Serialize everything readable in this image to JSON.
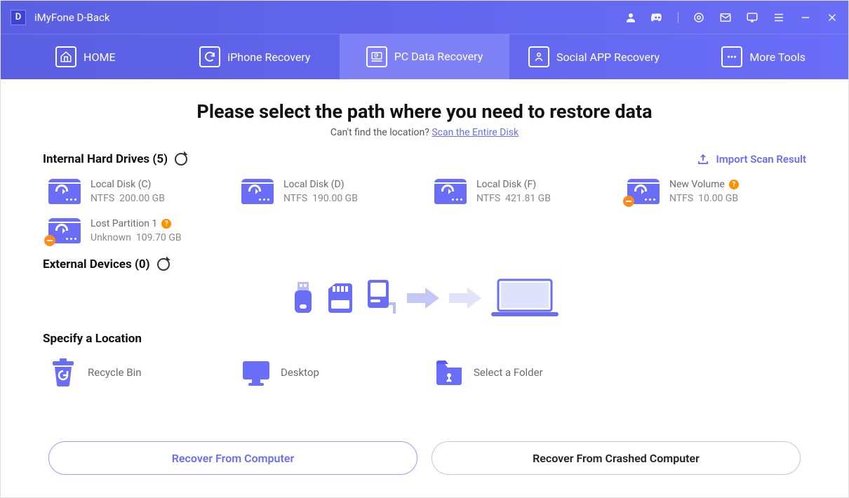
{
  "app": {
    "name": "iMyFone D-Back",
    "logo_letter": "D"
  },
  "titlebar_icons": [
    "user-icon",
    "discord-icon",
    "settings-icon",
    "mail-icon",
    "feedback-icon",
    "menu-icon",
    "minimize-icon",
    "close-icon"
  ],
  "tabs": [
    {
      "label": "HOME"
    },
    {
      "label": "iPhone Recovery"
    },
    {
      "label": "PC Data Recovery"
    },
    {
      "label": "Social APP Recovery"
    },
    {
      "label": "More Tools"
    }
  ],
  "active_tab_index": 2,
  "headline": "Please select the path where you need to restore data",
  "subline_prefix": "Can't find the location? ",
  "subline_link": "Scan the Entire Disk",
  "import_link": "Import Scan Result",
  "sections": {
    "internal": {
      "title": "Internal Hard Drives (5)"
    },
    "external": {
      "title": "External Devices (0)"
    },
    "specify": {
      "title": "Specify a Location"
    }
  },
  "drives": [
    {
      "name": "Local Disk (C)",
      "fs": "NTFS",
      "size": "200.00 GB",
      "warn": false,
      "q": false
    },
    {
      "name": "Local Disk (D)",
      "fs": "NTFS",
      "size": "190.00 GB",
      "warn": false,
      "q": false
    },
    {
      "name": "Local Disk (F)",
      "fs": "NTFS",
      "size": "421.81 GB",
      "warn": false,
      "q": false
    },
    {
      "name": "New Volume",
      "fs": "NTFS",
      "size": "10.00 GB",
      "warn": true,
      "q": true
    },
    {
      "name": "Lost Partition 1",
      "fs": "Unknown",
      "size": "109.70 GB",
      "warn": true,
      "q": true
    }
  ],
  "locations": [
    {
      "label": "Recycle Bin"
    },
    {
      "label": "Desktop"
    },
    {
      "label": "Select a Folder"
    }
  ],
  "buttons": {
    "primary": "Recover From Computer",
    "secondary": "Recover From Crashed Computer"
  }
}
